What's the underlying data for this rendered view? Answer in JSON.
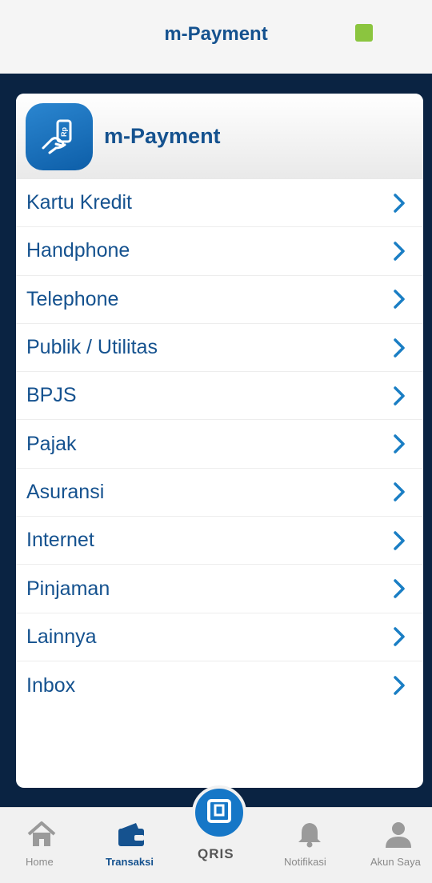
{
  "app": {
    "title": "m-Payment",
    "accent": "#15528f",
    "status_color": "#8bc53f",
    "background": "#0a2342"
  },
  "card": {
    "title": "m-Payment",
    "logo_icon": "phone-rupiah-hand-icon"
  },
  "menu": [
    {
      "label": "Kartu Kredit"
    },
    {
      "label": "Handphone"
    },
    {
      "label": "Telephone"
    },
    {
      "label": "Publik / Utilitas"
    },
    {
      "label": "BPJS"
    },
    {
      "label": "Pajak"
    },
    {
      "label": "Asuransi"
    },
    {
      "label": "Internet"
    },
    {
      "label": "Pinjaman"
    },
    {
      "label": "Lainnya"
    },
    {
      "label": "Inbox"
    }
  ],
  "bottom_nav": {
    "items": [
      {
        "label": "Home",
        "icon": "home-icon",
        "active": false
      },
      {
        "label": "Transaksi",
        "icon": "wallet-icon",
        "active": true
      },
      {
        "label": "Notifikasi",
        "icon": "bell-icon",
        "active": false
      },
      {
        "label": "Akun Saya",
        "icon": "user-icon",
        "active": false
      }
    ],
    "center": {
      "label": "QRIS",
      "icon": "qris-icon"
    }
  }
}
